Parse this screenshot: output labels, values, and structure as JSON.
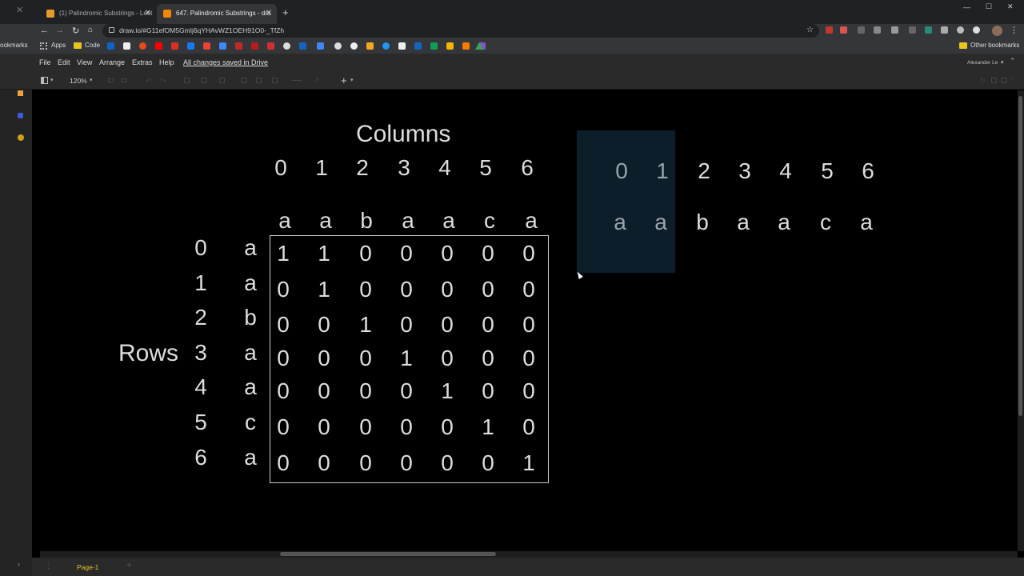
{
  "browser": {
    "tabs": [
      {
        "title": "(1) Palindromic Substrings - Leet"
      },
      {
        "title": "647. Palindromic Substrings - dra"
      }
    ],
    "new_tab": "+",
    "url": "draw.io/#G11efOM5GmIj6qYHAvWZ1OEH91O0-_TfZh",
    "bookmarks": [
      "Apps",
      "Code"
    ],
    "other_bookmarks": "Other bookmarks",
    "left_bookmarks": "ookmarks",
    "window_controls": [
      "—",
      "☐",
      "✕"
    ]
  },
  "app": {
    "menu": [
      "File",
      "Edit",
      "View",
      "Arrange",
      "Extras",
      "Help"
    ],
    "saved_status": "All changes saved in Drive",
    "user": "Alexander Le",
    "zoom": "120%",
    "page_tab": "Page-1",
    "add_page": "+"
  },
  "diagram": {
    "columns_title": "Columns",
    "rows_title": "Rows",
    "col_indices": [
      "0",
      "1",
      "2",
      "3",
      "4",
      "5",
      "6"
    ],
    "col_chars": [
      "a",
      "a",
      "b",
      "a",
      "a",
      "c",
      "a"
    ],
    "row_indices": [
      "0",
      "1",
      "2",
      "3",
      "4",
      "5",
      "6"
    ],
    "row_chars": [
      "a",
      "a",
      "b",
      "a",
      "a",
      "c",
      "a"
    ],
    "matrix": [
      [
        "1",
        "1",
        "0",
        "0",
        "0",
        "0",
        "0"
      ],
      [
        "0",
        "1",
        "0",
        "0",
        "0",
        "0",
        "0"
      ],
      [
        "0",
        "0",
        "1",
        "0",
        "0",
        "0",
        "0"
      ],
      [
        "0",
        "0",
        "0",
        "1",
        "0",
        "0",
        "0"
      ],
      [
        "0",
        "0",
        "0",
        "0",
        "1",
        "0",
        "0"
      ],
      [
        "0",
        "0",
        "0",
        "0",
        "0",
        "1",
        "0"
      ],
      [
        "0",
        "0",
        "0",
        "0",
        "0",
        "0",
        "1"
      ]
    ],
    "right_indices": [
      "0",
      "1",
      "2",
      "3",
      "4",
      "5",
      "6"
    ],
    "right_chars": [
      "a",
      "a",
      "b",
      "a",
      "a",
      "c",
      "a"
    ]
  },
  "colors": {
    "background": "#000000",
    "text": "#dddddd",
    "highlight": "#0d1e2b",
    "accent": "#e8c41e"
  }
}
